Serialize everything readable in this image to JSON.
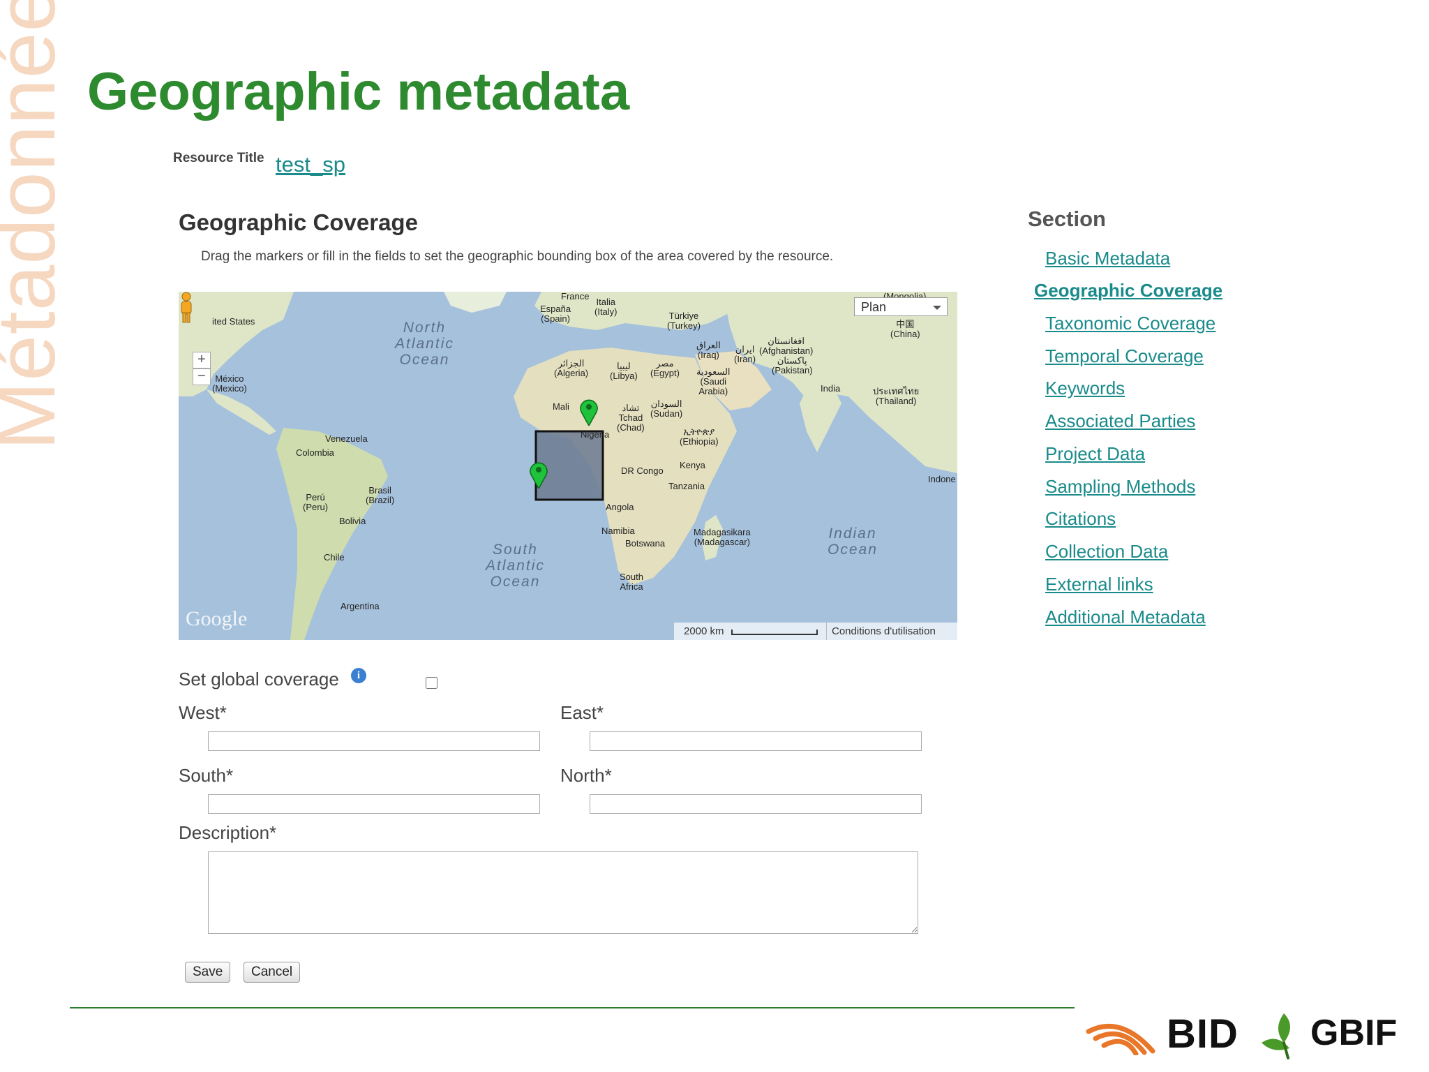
{
  "slide": {
    "side_watermark": "Métadonnées",
    "title": "Geographic metadata"
  },
  "resource": {
    "label": "Resource Title",
    "title": "test_sp"
  },
  "coverage": {
    "heading": "Geographic Coverage",
    "help_text": "Drag the markers or fill in the fields to set the geographic bounding box of the area covered by the resource."
  },
  "map": {
    "type_selector": "Plan",
    "zoom_in": "+",
    "zoom_out": "−",
    "provider_logo": "Google",
    "scale_label": "2000 km",
    "terms_link": "Conditions d'utilisation",
    "oceans": {
      "north_atlantic": "North\nAtlantic\nOcean",
      "south_atlantic": "South\nAtlantic\nOcean",
      "indian": "Indian\nOcean"
    },
    "countries": {
      "us": "ited States",
      "mexico": "México\n(Mexico)",
      "venezuela": "Venezuela",
      "colombia": "Colombia",
      "peru": "Perú\n(Peru)",
      "brasil": "Brasil\n(Brazil)",
      "bolivia": "Bolivia",
      "chile": "Chile",
      "argentina": "Argentina",
      "france": "France",
      "espana": "España\n(Spain)",
      "italia": "Italia\n(Italy)",
      "turkiye": "Türkiye\n(Turkey)",
      "algeria": "الجزائر\n(Algeria)",
      "libya": "ليبيا\n(Libya)",
      "egypt": "مصر\n(Egypt)",
      "iraq": "العراق\n(Iraq)",
      "iran": "ایران\n(Iran)",
      "afghanistan": "افغانستان\n(Afghanistan)",
      "pakistan": "پاکستان\n(Pakistan)",
      "saudi": "السعودية\n(Saudi\nArabia)",
      "india": "India",
      "mongolia": "(Mongolia)",
      "china": "中国\n(China)",
      "thailand": "ประเทศไทย\n(Thailand)",
      "mali": "Mali",
      "niger": "Nigeria",
      "chad": "تشاد\nTchad\n(Chad)",
      "sudan": "السودان\n(Sudan)",
      "ethiopia": "ኢትዮጵያ\n(Ethiopia)",
      "kenya": "Kenya",
      "drcongo": "DR Congo",
      "tanzania": "Tanzania",
      "angola": "Angola",
      "namibia": "Namibia",
      "botswana": "Botswana",
      "madagascar": "Madagasikara\n(Madagascar)",
      "southafrica": "South\nAfrica",
      "indonesia": "Indone"
    }
  },
  "global": {
    "label": "Set global coverage",
    "info_icon": "i",
    "checked": false
  },
  "fields": {
    "west": {
      "label": "West*",
      "value": ""
    },
    "east": {
      "label": "East*",
      "value": ""
    },
    "south": {
      "label": "South*",
      "value": ""
    },
    "north": {
      "label": "North*",
      "value": ""
    },
    "description": {
      "label": "Description*",
      "value": ""
    }
  },
  "buttons": {
    "save": "Save",
    "cancel": "Cancel"
  },
  "section_nav": {
    "heading": "Section",
    "items": [
      {
        "label": "Basic Metadata",
        "active": false
      },
      {
        "label": "Geographic Coverage",
        "active": true
      },
      {
        "label": "Taxonomic Coverage",
        "active": false
      },
      {
        "label": "Temporal Coverage",
        "active": false
      },
      {
        "label": "Keywords",
        "active": false
      },
      {
        "label": "Associated Parties",
        "active": false
      },
      {
        "label": "Project Data",
        "active": false
      },
      {
        "label": "Sampling Methods",
        "active": false
      },
      {
        "label": "Citations",
        "active": false
      },
      {
        "label": "Collection Data",
        "active": false
      },
      {
        "label": "External links",
        "active": false
      },
      {
        "label": "Additional Metadata",
        "active": false
      }
    ]
  },
  "logos": {
    "bid": "BID",
    "gbif": "GBIF"
  },
  "colors": {
    "title_green": "#2e8a2e",
    "link_teal": "#1a8a8a",
    "watermark": "#f6d7c0",
    "ocean": "#a6c1dc",
    "land": "#dfe6c8",
    "marker": "#1fc23a",
    "bbox_fill": "#6b7a90",
    "bid_orange": "#e8772a",
    "gbif_green": "#4a9a2a"
  }
}
